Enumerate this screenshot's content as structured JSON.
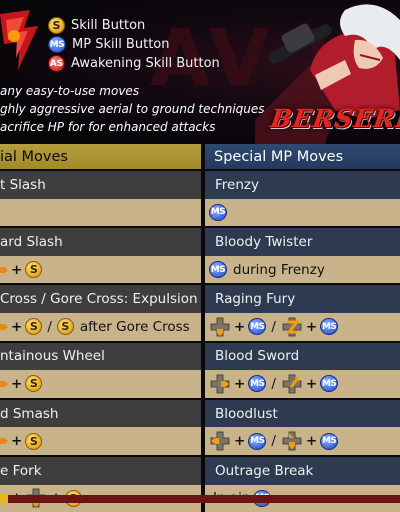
{
  "header": {
    "legend": [
      {
        "icon": "s-button-icon",
        "glyph": "S",
        "label": "Skill Button"
      },
      {
        "icon": "ms-button-icon",
        "glyph": "MS",
        "label": "MP Skill Button"
      },
      {
        "icon": "as-button-icon",
        "glyph": "AS",
        "label": "Awakening Skill Button"
      }
    ],
    "bullets": [
      "any easy-to-use moves",
      "ghly aggressive aerial to ground techniques",
      "acrifice HP for for enhanced attacks"
    ],
    "class_title": "BERSERKE"
  },
  "table": {
    "left_header": "ial Moves",
    "right_header": "Special MP Moves",
    "rows": [
      {
        "left_name": "t Slash",
        "right_name": "Frenzy"
      },
      {
        "left_name": "ard Slash",
        "right_name": "Bloody Twister"
      },
      {
        "left_name": " Cross / Gore Cross: Expulsion",
        "right_name": "Raging Fury"
      },
      {
        "left_name": "ntainous Wheel",
        "right_name": "Blood Sword"
      },
      {
        "left_name": "d Smash",
        "right_name": "Bloodlust"
      },
      {
        "left_name": "e Fork",
        "right_name": "Outrage Break"
      }
    ],
    "inputs": {
      "r1_right": "MS",
      "r2_right_suffix": "during Frenzy",
      "r3_left_suffix": "after Gore Cross",
      "r6_right_prefix": "In air"
    }
  },
  "colors": {
    "left_header": "#b59e3c",
    "right_header": "#2f4a70",
    "input_row": "#c9b38a",
    "title_red": "#e4241f"
  }
}
